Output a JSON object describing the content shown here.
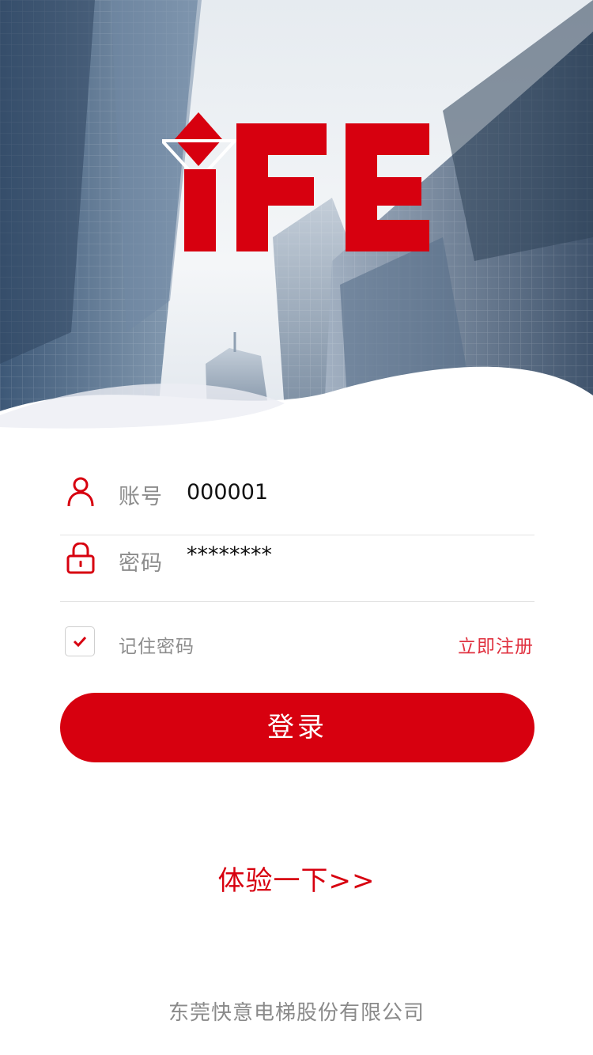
{
  "brand": {
    "logo_text": "IFE",
    "accent_color": "#d7000f"
  },
  "login_form": {
    "account_label": "账号",
    "account_value": "000001",
    "password_label": "密码",
    "password_value": "********",
    "remember_label": "记住密码",
    "remember_checked": true,
    "register_link": "立即注册",
    "login_button": "登录"
  },
  "trial_link": "体验一下>>",
  "footer": {
    "company_name": "东莞快意电梯股份有限公司"
  },
  "icons": {
    "account": "user-icon",
    "password": "lock-icon",
    "remember": "checkmark-icon"
  }
}
